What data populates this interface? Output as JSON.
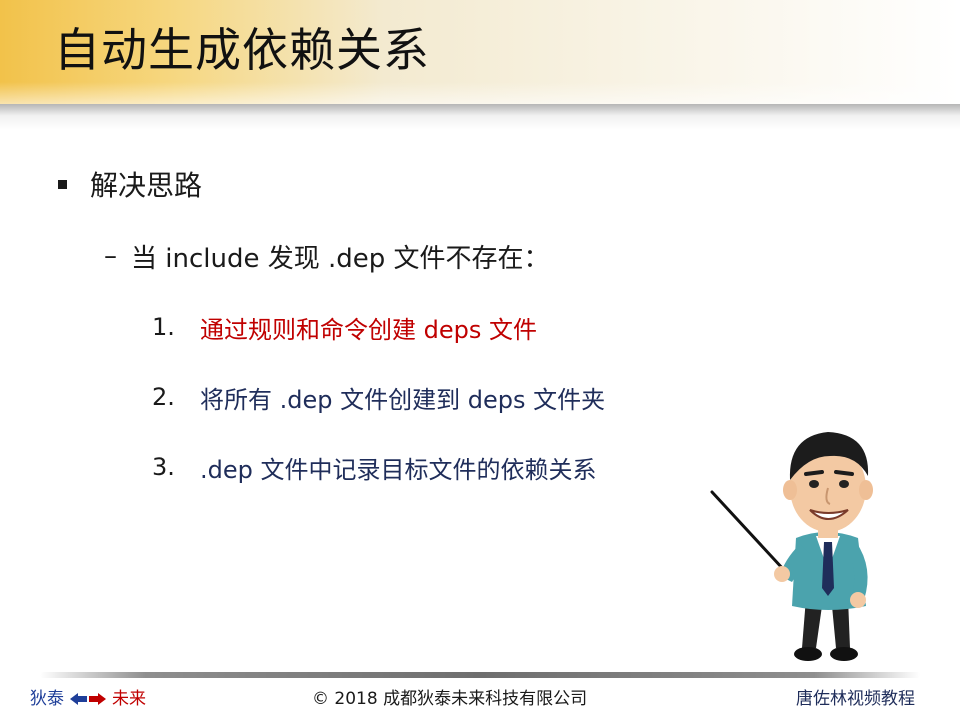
{
  "slide": {
    "title": "自动生成依赖关系",
    "bullet": "解决思路",
    "sub_bullet": "当 include 发现 .dep 文件不存在：",
    "steps": [
      {
        "number": "1.",
        "text": "通过规则和命令创建 deps 文件"
      },
      {
        "number": "2.",
        "text": "将所有 .dep 文件创建到 deps 文件夹"
      },
      {
        "number": "3.",
        "text": ".dep 文件中记录目标文件的依赖关系"
      }
    ]
  },
  "footer": {
    "left_a": "狄泰",
    "left_b": "未来",
    "center": "© 2018 成都狄泰未来科技有限公司",
    "right": "唐佐林视频教程"
  },
  "colors": {
    "title_band": "#f2c24a",
    "highlight_red": "#c00000",
    "step_blue": "#1f2d5a",
    "footer_blue": "#1f3f99"
  },
  "icons": {
    "bullet": "square-bullet-icon",
    "arrows": "bidirectional-arrow-icon",
    "illustration": "teacher-with-pointer-illustration"
  }
}
